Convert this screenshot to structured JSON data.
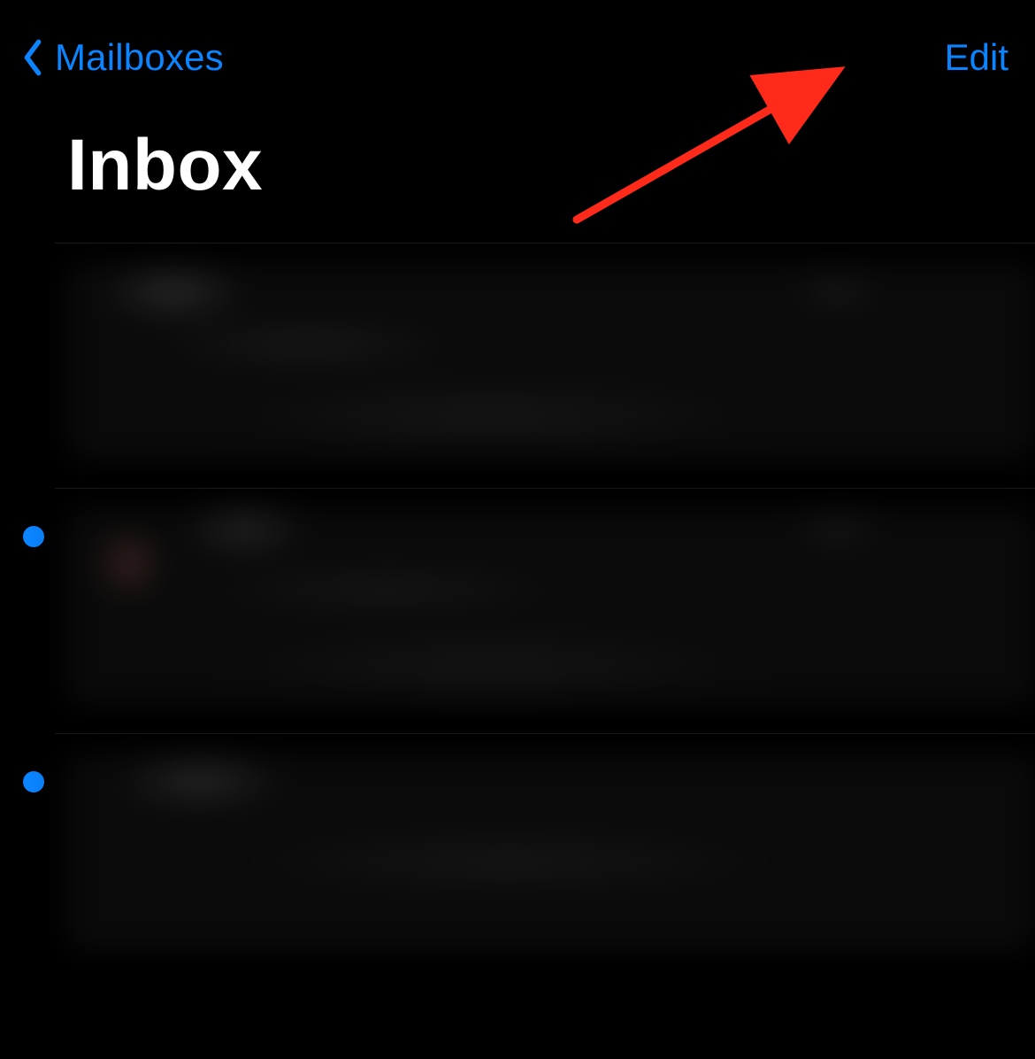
{
  "nav": {
    "back_label": "Mailboxes",
    "edit_label": "Edit"
  },
  "page": {
    "title": "Inbox"
  },
  "messages": [
    {
      "unread": false
    },
    {
      "unread": true
    },
    {
      "unread": true
    }
  ],
  "colors": {
    "accent": "#0b84ff",
    "annotation": "#ff2a1a"
  }
}
